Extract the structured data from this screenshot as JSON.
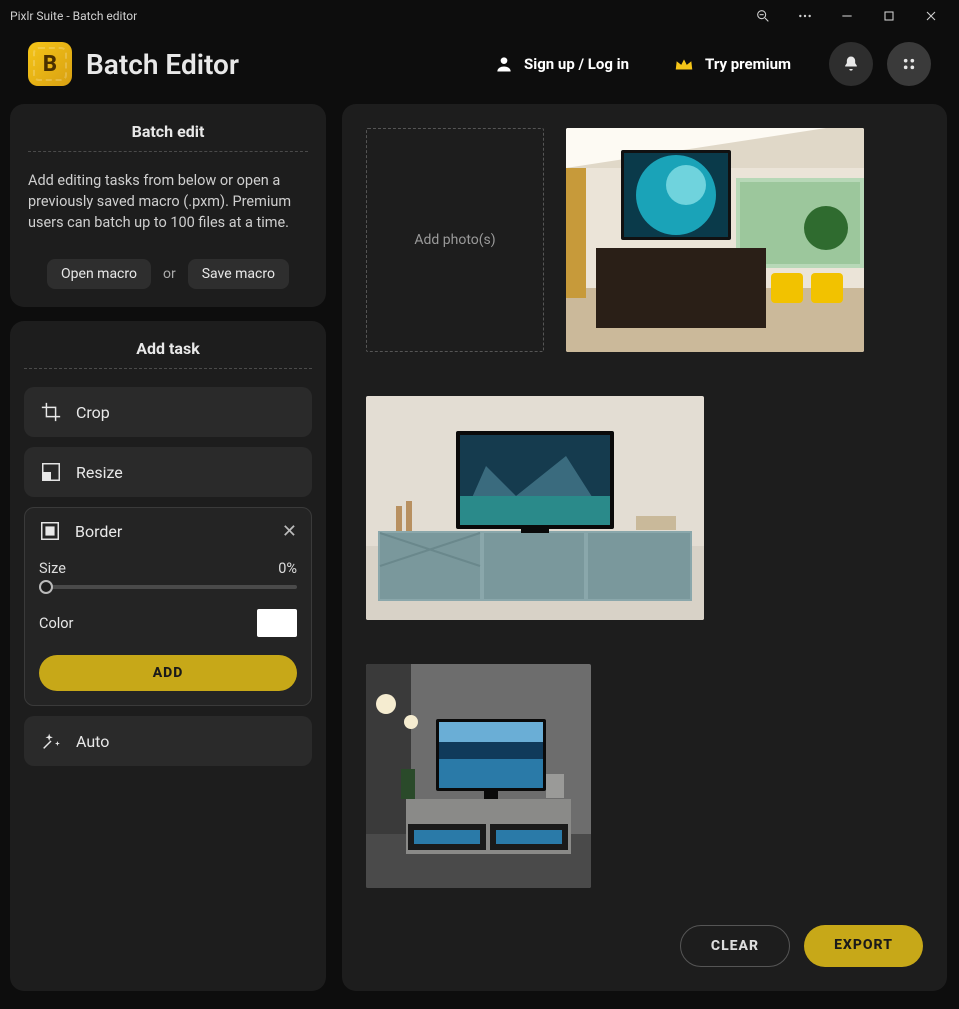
{
  "window": {
    "title": "Pixlr Suite - Batch editor"
  },
  "header": {
    "app_title": "Batch Editor",
    "logo_letter": "B",
    "signup": "Sign up / Log in",
    "premium": "Try premium"
  },
  "batch_panel": {
    "title": "Batch edit",
    "desc": "Add editing tasks from below or open a previously saved macro (.pxm). Premium users can batch up to 100 files at a time.",
    "open_macro": "Open macro",
    "or": "or",
    "save_macro": "Save macro"
  },
  "task_panel": {
    "title": "Add task",
    "tasks": {
      "crop": "Crop",
      "resize": "Resize",
      "border": {
        "label": "Border",
        "size_label": "Size",
        "size_value": "0%",
        "color_label": "Color",
        "color_value": "#ffffff",
        "add": "ADD"
      },
      "auto": "Auto"
    }
  },
  "right": {
    "add_photos": "Add photo(s)",
    "clear": "CLEAR",
    "export": "EXPORT"
  }
}
